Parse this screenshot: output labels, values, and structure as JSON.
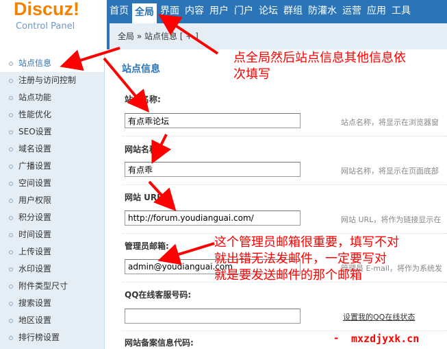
{
  "header": {
    "logo": "Discuz!",
    "logo_sub": "Control Panel",
    "nav": [
      {
        "label": "首页",
        "active": false
      },
      {
        "label": "全局",
        "active": true
      },
      {
        "label": "界面",
        "active": false
      },
      {
        "label": "内容",
        "active": false
      },
      {
        "label": "用户",
        "active": false
      },
      {
        "label": "门户",
        "active": false
      },
      {
        "label": "论坛",
        "active": false
      },
      {
        "label": "群组",
        "active": false
      },
      {
        "label": "防灌水",
        "active": false
      },
      {
        "label": "运营",
        "active": false
      },
      {
        "label": "应用",
        "active": false
      },
      {
        "label": "工具",
        "active": false
      }
    ]
  },
  "breadcrumb": "全局 » 站点信息 [ + ]",
  "sidebar": {
    "items": [
      {
        "label": "站点信息",
        "active": true
      },
      {
        "label": "注册与访问控制",
        "active": false
      },
      {
        "label": "站点功能",
        "active": false
      },
      {
        "label": "性能优化",
        "active": false
      },
      {
        "label": "SEO设置",
        "active": false
      },
      {
        "label": "域名设置",
        "active": false
      },
      {
        "label": "广播设置",
        "active": false
      },
      {
        "label": "空间设置",
        "active": false
      },
      {
        "label": "用户权限",
        "active": false
      },
      {
        "label": "积分设置",
        "active": false
      },
      {
        "label": "时间设置",
        "active": false
      },
      {
        "label": "上传设置",
        "active": false
      },
      {
        "label": "水印设置",
        "active": false
      },
      {
        "label": "附件类型尺寸",
        "active": false
      },
      {
        "label": "搜索设置",
        "active": false
      },
      {
        "label": "地区设置",
        "active": false
      },
      {
        "label": "排行榜设置",
        "active": false
      }
    ]
  },
  "main": {
    "title": "站点信息",
    "fields": {
      "site_name": {
        "label": "站点名称:",
        "value": "有点乖论坛",
        "hint": "站点名称，将显示在浏览器窗"
      },
      "web_name": {
        "label": "网站名称:",
        "value": "有点乖",
        "hint": "网站名称，将显示在页面底部"
      },
      "web_url": {
        "label": "网站 URL:",
        "value": "http://forum.youdianguai.com/",
        "hint": "网站 URL，将作为链接显示在"
      },
      "admin_email": {
        "label": "管理员邮箱:",
        "value": "admin@youdianguai.com",
        "hint": "管理员 E-mail，将作为系统发"
      },
      "qq": {
        "label": "QQ在线客服号码:",
        "value": "",
        "link": "设置我的QQ在线状态"
      },
      "icp": {
        "label": "网站备案信息代码:"
      }
    }
  },
  "annotations": {
    "global": [
      "点全局然后站点信息其他信息依",
      "次填写"
    ],
    "email": [
      "这个管理员邮箱很重要，填写不对",
      "就出错无法发邮件，一定要写对",
      "就是要发送邮件的那个邮箱"
    ]
  },
  "watermark": "mxzdjyxk.cn",
  "watermark_dash": "-",
  "colors": {
    "accent": "#2a74b7",
    "logo": "#f08200",
    "annotation": "#ff0000"
  }
}
